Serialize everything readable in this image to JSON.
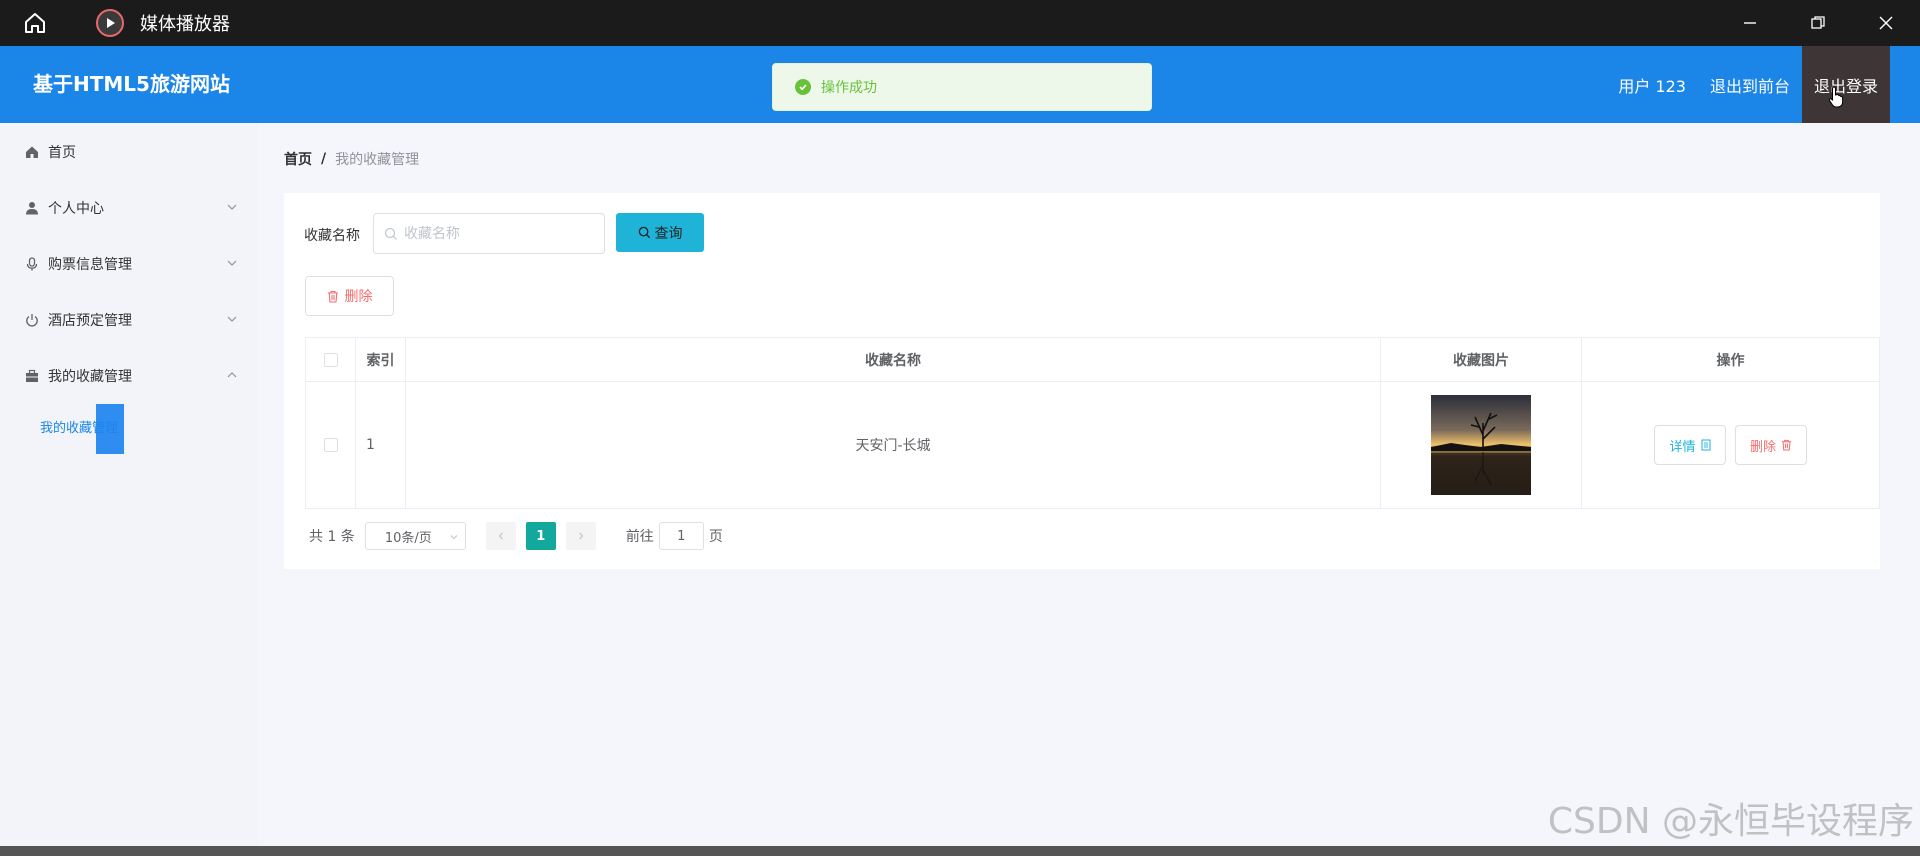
{
  "window": {
    "title": "媒体播放器"
  },
  "header": {
    "brand": "基于HTML5旅游网站",
    "user": "用户 123",
    "back_to_front": "退出到前台",
    "logout": "退出登录"
  },
  "toast": {
    "message": "操作成功"
  },
  "sidebar": {
    "items": [
      {
        "label": "首页",
        "icon": "home-icon"
      },
      {
        "label": "个人中心",
        "icon": "user-icon"
      },
      {
        "label": "购票信息管理",
        "icon": "microphone-icon"
      },
      {
        "label": "酒店预定管理",
        "icon": "power-icon"
      },
      {
        "label": "我的收藏管理",
        "icon": "briefcase-icon"
      }
    ],
    "sub_item": "我的收藏管理"
  },
  "breadcrumb": {
    "home": "首页",
    "separator": "/",
    "current": "我的收藏管理"
  },
  "search": {
    "label": "收藏名称",
    "placeholder": "收藏名称",
    "value": "",
    "button": "查询"
  },
  "actions": {
    "delete": "删除"
  },
  "table": {
    "columns": [
      "索引",
      "收藏名称",
      "收藏图片",
      "操作"
    ],
    "rows": [
      {
        "index": "1",
        "name": "天安门-长城",
        "detail": "详情",
        "delete": "删除"
      }
    ]
  },
  "pagination": {
    "total": "共 1 条",
    "page_size": "10条/页",
    "current_page": "1",
    "goto_prefix": "前往",
    "goto_value": "1",
    "goto_suffix": "页"
  },
  "watermark": "CSDN @永恒毕设程序",
  "colors": {
    "header": "#1c86e8",
    "success": "#67c23a",
    "query_button": "#1eb3d7",
    "danger": "#f56c6c",
    "active_page": "#13a89e"
  }
}
